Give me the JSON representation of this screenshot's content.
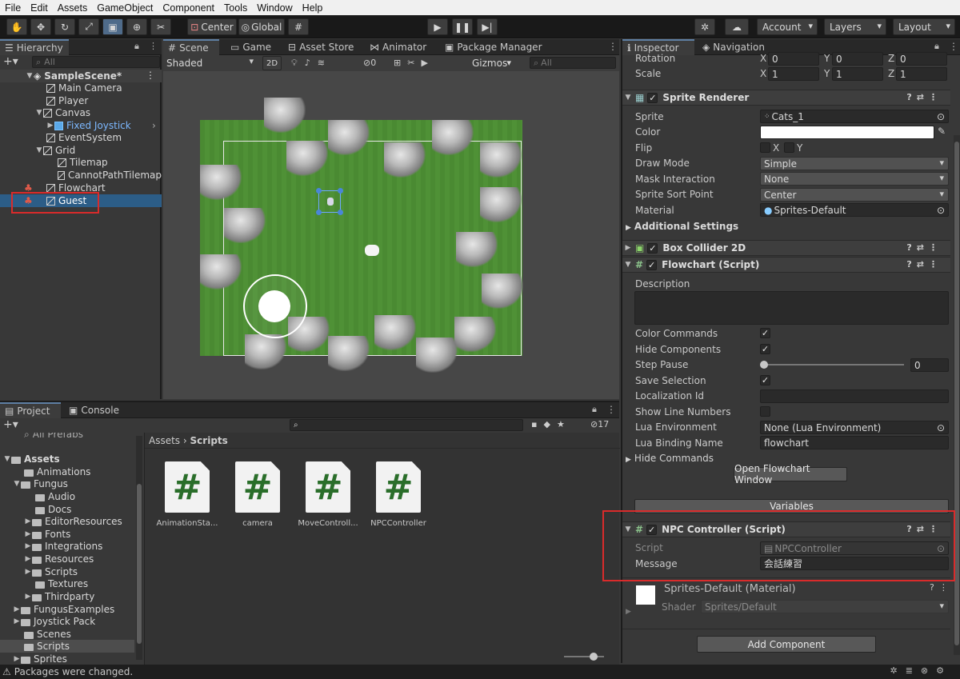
{
  "menu": [
    "File",
    "Edit",
    "Assets",
    "GameObject",
    "Component",
    "Tools",
    "Window",
    "Help"
  ],
  "toolbar": {
    "center": "Center",
    "global": "Global",
    "account": "Account",
    "layers": "Layers",
    "layout": "Layout"
  },
  "hierarchy": {
    "tab": "Hierarchy",
    "search_placeholder": "All",
    "scene": "SampleScene*",
    "items": [
      "Main Camera",
      "Player",
      "Canvas",
      "Fixed Joystick",
      "EventSystem",
      "Grid",
      "Tilemap",
      "CannotPathTilemap",
      "Flowchart",
      "Guest"
    ]
  },
  "scene_tabs": [
    "Scene",
    "Game",
    "Asset Store",
    "Animator",
    "Package Manager"
  ],
  "scene_toolbar": {
    "shading": "Shaded",
    "mode2d": "2D",
    "hidden_count": "0",
    "gizmos": "Gizmos",
    "search_placeholder": "All"
  },
  "project": {
    "tabs": [
      "Project",
      "Console"
    ],
    "count": "17",
    "breadcrumb": [
      "Assets",
      "Scripts"
    ],
    "tree": [
      "All Prefabs",
      "Assets",
      "Animations",
      "Fungus",
      "Audio",
      "Docs",
      "EditorResources",
      "Fonts",
      "Integrations",
      "Resources",
      "Scripts",
      "Textures",
      "Thirdparty",
      "FungusExamples",
      "Joystick Pack",
      "Scenes",
      "Scripts",
      "Sprites"
    ],
    "files": [
      "AnimationSta...",
      "camera",
      "MoveControll...",
      "NPCController"
    ]
  },
  "status": "Packages were changed.",
  "inspector": {
    "tabs": [
      "Inspector",
      "Navigation"
    ],
    "transform": {
      "rotation_label": "Rotation",
      "rotation": [
        "0",
        "0",
        "0"
      ],
      "scale_label": "Scale",
      "scale": [
        "1",
        "1",
        "1"
      ],
      "axes": [
        "X",
        "Y",
        "Z"
      ]
    },
    "sprite_renderer": {
      "title": "Sprite Renderer",
      "sprite_label": "Sprite",
      "sprite": "Cats_1",
      "color_label": "Color",
      "flip_label": "Flip",
      "flip_x": "X",
      "flip_y": "Y",
      "draw_mode_label": "Draw Mode",
      "draw_mode": "Simple",
      "mask_label": "Mask Interaction",
      "mask": "None",
      "sort_label": "Sprite Sort Point",
      "sort": "Center",
      "material_label": "Material",
      "material": "Sprites-Default",
      "additional": "Additional Settings"
    },
    "box_collider": {
      "title": "Box Collider 2D"
    },
    "flowchart": {
      "title": "Flowchart (Script)",
      "description_label": "Description",
      "color_commands": "Color Commands",
      "hide_components": "Hide Components",
      "step_pause": "Step Pause",
      "step_pause_value": "0",
      "save_selection": "Save Selection",
      "localization": "Localization Id",
      "show_line_numbers": "Show Line Numbers",
      "lua_env_label": "Lua Environment",
      "lua_env": "None (Lua Environment)",
      "lua_binding_label": "Lua Binding Name",
      "lua_binding": "flowchart",
      "hide_commands": "Hide Commands",
      "open_button": "Open Flowchart Window",
      "variables": "Variables"
    },
    "npc": {
      "title": "NPC Controller (Script)",
      "script_label": "Script",
      "script": "NPCController",
      "message_label": "Message",
      "message": "会話練習"
    },
    "material": {
      "title": "Sprites-Default (Material)",
      "shader_label": "Shader",
      "shader": "Sprites/Default"
    },
    "add_component": "Add Component"
  },
  "colors": {
    "highlight": "#2c5d87",
    "red_box": "#d92b2b",
    "grass": "#4e8a35"
  }
}
